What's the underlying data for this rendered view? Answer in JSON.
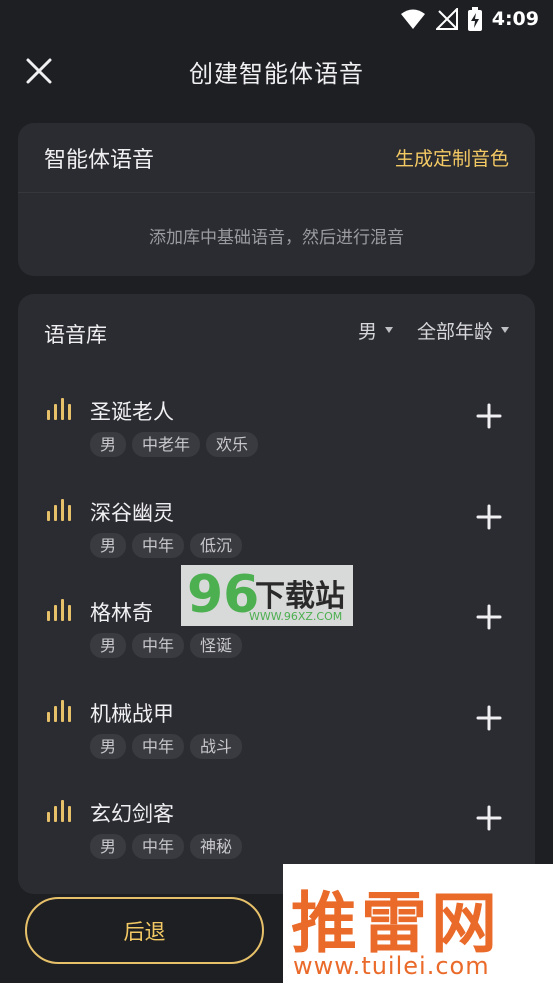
{
  "status": {
    "time": "4:09"
  },
  "header": {
    "title": "创建智能体语音"
  },
  "agent_card": {
    "title": "智能体语音",
    "custom_link": "生成定制音色",
    "hint": "添加库中基础语音，然后进行混音"
  },
  "library": {
    "title": "语音库",
    "filter_gender": "男",
    "filter_age": "全部年龄",
    "items": [
      {
        "name": "圣诞老人",
        "tags": [
          "男",
          "中老年",
          "欢乐"
        ]
      },
      {
        "name": "深谷幽灵",
        "tags": [
          "男",
          "中年",
          "低沉"
        ]
      },
      {
        "name": "格林奇",
        "tags": [
          "男",
          "中年",
          "怪诞"
        ]
      },
      {
        "name": "机械战甲",
        "tags": [
          "男",
          "中年",
          "战斗"
        ]
      },
      {
        "name": "玄幻剑客",
        "tags": [
          "男",
          "中年",
          "神秘"
        ]
      }
    ]
  },
  "footer": {
    "back_label": "后退"
  },
  "watermarks": {
    "wm96_num": "96",
    "wm96_text": "下载站",
    "wm96_url": "WWW.96XZ.COM",
    "tl_text": "推雷网",
    "tl_url": "www.tuilei.com"
  },
  "colors": {
    "accent": "#f3c964",
    "background": "#1e1f23",
    "card": "#2b2c31"
  }
}
